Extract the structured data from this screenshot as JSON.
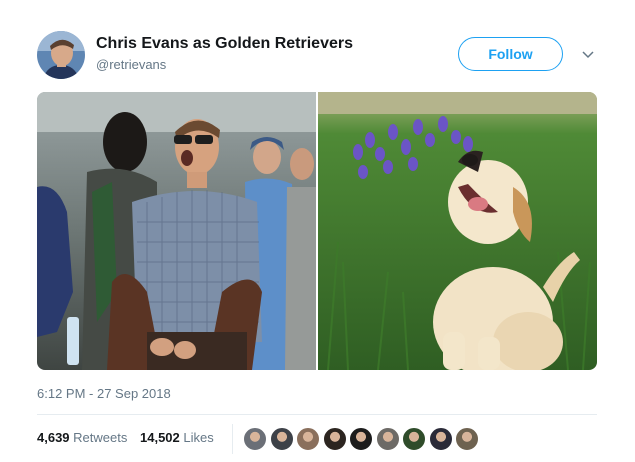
{
  "tweet": {
    "author": {
      "name": "Chris Evans as Golden Retrievers",
      "handle": "@retrievans"
    },
    "follow_label": "Follow",
    "timestamp": "6:12 PM - 27 Sep 2018",
    "retweets": {
      "count": "4,639",
      "label": "Retweets"
    },
    "likes": {
      "count": "14,502",
      "label": "Likes"
    },
    "likers": [
      {
        "color": "#6b6f77"
      },
      {
        "color": "#3d4148"
      },
      {
        "color": "#8a6f5c"
      },
      {
        "color": "#2c2520"
      },
      {
        "color": "#1c1c1c"
      },
      {
        "color": "#6d6a66"
      },
      {
        "color": "#2f4c2a"
      },
      {
        "color": "#2a2a38"
      },
      {
        "color": "#6e6250"
      }
    ]
  },
  "colors": {
    "accent": "#1da1f2",
    "text": "#14171a",
    "secondary": "#657786"
  }
}
